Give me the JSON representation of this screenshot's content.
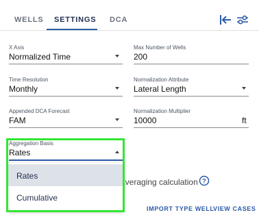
{
  "tabs": [
    {
      "label": "WELLS"
    },
    {
      "label": "SETTINGS"
    },
    {
      "label": "DCA"
    }
  ],
  "active_tab": "SETTINGS",
  "icons": {
    "collapse": "collapse-left-icon",
    "filters": "sliders-icon",
    "help": "help-circle-icon"
  },
  "fields": {
    "x_axis": {
      "label": "X Axis",
      "value": "Normalized Time"
    },
    "max_wells": {
      "label": "Max Number of Wells",
      "value": "200"
    },
    "time_resolution": {
      "label": "Time Resolution",
      "value": "Monthly"
    },
    "normalization_attribute": {
      "label": "Normalization Attribute",
      "value": "Lateral Length"
    },
    "appended_dca": {
      "label": "Appended DCA Forecast",
      "value": "FAM"
    },
    "normalization_multiplier": {
      "label": "Normalization Multiplier",
      "value": "10000",
      "unit": "ft"
    },
    "aggregation_basis": {
      "label": "Aggregation Basis",
      "value": "Rates"
    }
  },
  "dropdown": {
    "options": [
      {
        "label": "Rates",
        "selected": true
      },
      {
        "label": "Cumulative",
        "selected": false
      }
    ]
  },
  "averaging_text": "averaging calculation",
  "actions": {
    "import": "IMPORT TYPE WELL",
    "view": "VIEW CASES"
  },
  "colors": {
    "accent": "#2b5aa8",
    "highlight": "#32e632",
    "selected_bg": "#dde1e8"
  }
}
